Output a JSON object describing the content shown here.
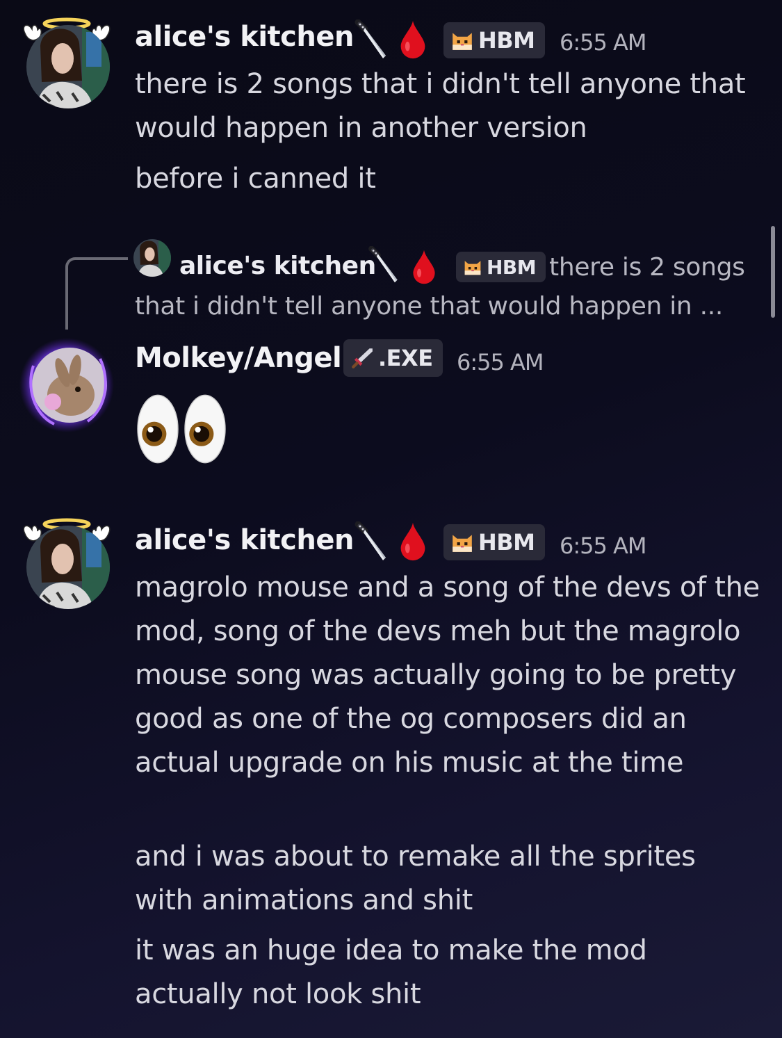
{
  "messages": [
    {
      "username": "alice's kitchen",
      "tag": "HBM",
      "time": "6:55 AM",
      "lines": [
        "there is 2 songs that i didn't tell anyone that would happen in another version",
        "before i canned it"
      ]
    },
    {
      "reply": {
        "username": "alice's kitchen",
        "tag": "HBM",
        "snippet_start": "there is 2 songs",
        "snippet_rest": "that i didn't tell anyone that would happen in ..."
      },
      "username": "Molkey/Angel",
      "tag": ".EXE",
      "time": "6:55 AM",
      "content": "👀"
    },
    {
      "username": "alice's kitchen",
      "tag": "HBM",
      "time": "6:55 AM",
      "lines": [
        "magrolo mouse and a song of the devs of the mod, song of the devs meh but the magrolo mouse song was actually going to be pretty good as one of the og composers did an actual upgrade on his music at the time",
        "and i was about to remake all the sprites with animations and shit",
        "it was an huge idea to make the mod actually not look shit"
      ]
    }
  ],
  "colors": {
    "background": "#0c0c1e",
    "tag_bg": "#2a2a38",
    "username": "#f2f2f5",
    "timestamp": "#b3b3bd",
    "blood": "#e0101e"
  },
  "icons": [
    "knife-icon",
    "blood-drop-icon",
    "cat-tag-icon",
    "sword-tag-icon",
    "eyes-emoji",
    "halo-icon"
  ]
}
